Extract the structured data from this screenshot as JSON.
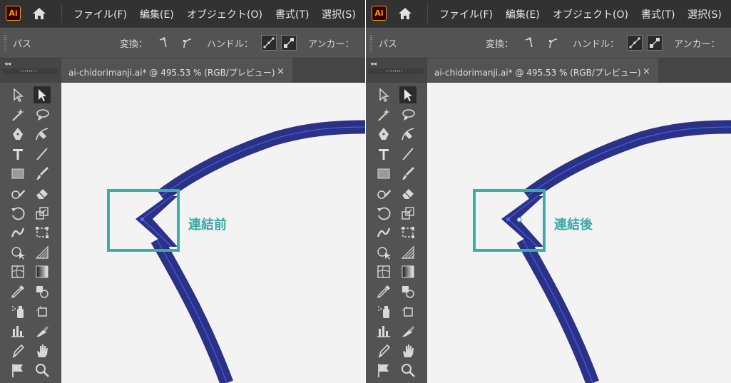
{
  "app": {
    "logo_text": "Ai"
  },
  "menu": [
    "ファイル(F)",
    "編集(E)",
    "オブジェクト(O)",
    "書式(T)",
    "選択(S)"
  ],
  "control_bar": {
    "object_type": "パス",
    "convert_label": "変換：",
    "handle_label": "ハンドル：",
    "anchor_label": "アンカー："
  },
  "document_tab": {
    "title": "ai-chidorimanji.ai* @ 495.53 % (RGB/プレビュー)",
    "close": "×"
  },
  "tools": [
    "direct-selection",
    "selection",
    "magic-wand",
    "lasso",
    "pen",
    "curvature",
    "type",
    "line-segment",
    "rectangle",
    "paintbrush",
    "shaper",
    "eraser",
    "rotate",
    "scale",
    "width",
    "free-transform",
    "shape-builder",
    "perspective-grid",
    "mesh",
    "gradient",
    "eyedropper",
    "blend",
    "symbol-sprayer",
    "artboard",
    "column-graph",
    "slice",
    "pen-variant",
    "hand",
    "flag",
    "zoom"
  ],
  "panes": [
    {
      "state": "before",
      "annotation": "連結前"
    },
    {
      "state": "after",
      "annotation": "連結後"
    }
  ],
  "colors": {
    "stroke_navy": "#2b3185",
    "path_highlight": "#4a66ff",
    "callout_teal": "#3aada5",
    "canvas": "#f3f3f3",
    "ui_dark": "#323232",
    "ui_mid": "#535353"
  }
}
